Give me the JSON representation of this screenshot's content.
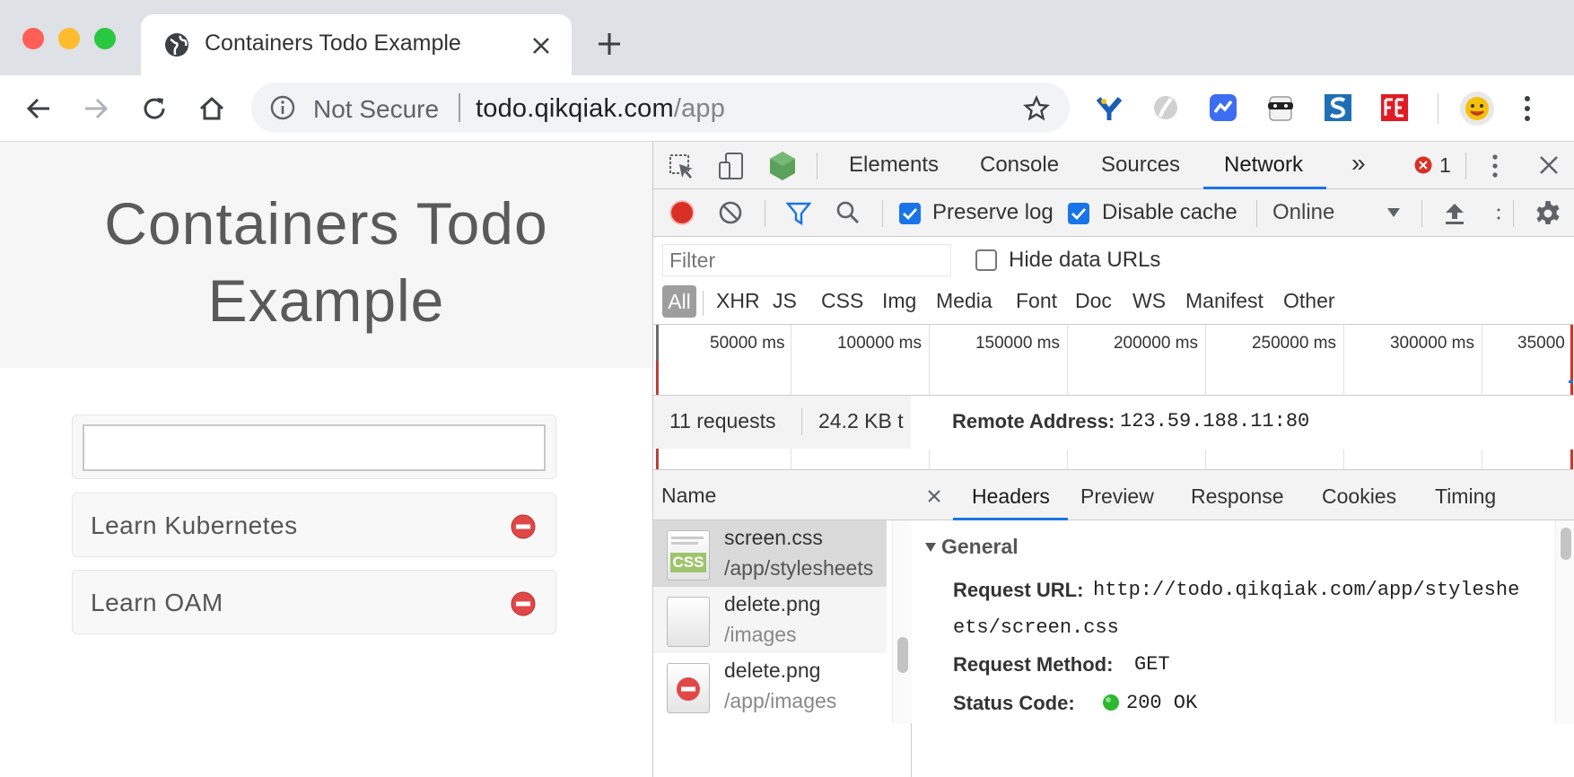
{
  "browser": {
    "tab_title": "Containers Todo Example",
    "omnibox": {
      "security_label": "Not Secure",
      "url_host": "todo.qikqiak.com",
      "url_path": "/app"
    }
  },
  "page": {
    "title_line1": "Containers Todo",
    "title_line2": "Example",
    "new_todo_value": "",
    "todos": [
      {
        "text": "Learn Kubernetes"
      },
      {
        "text": "Learn OAM"
      }
    ]
  },
  "devtools": {
    "tabs": [
      "Elements",
      "Console",
      "Sources",
      "Network"
    ],
    "active_tab": "Network",
    "more_tabs": "»",
    "error_count": "1",
    "controls": {
      "preserve_log": "Preserve log",
      "disable_cache": "Disable cache",
      "throttling": "Online"
    },
    "filter": {
      "placeholder": "Filter",
      "hide_data_urls": "Hide data URLs",
      "types": [
        "All",
        "XHR",
        "JS",
        "CSS",
        "Img",
        "Media",
        "Font",
        "Doc",
        "WS",
        "Manifest",
        "Other"
      ]
    },
    "overview_ticks": [
      "50000 ms",
      "100000 ms",
      "150000 ms",
      "200000 ms",
      "250000 ms",
      "300000 ms",
      "35000"
    ],
    "requests": {
      "column_name": "Name",
      "rows": [
        {
          "file": "screen.css",
          "path": "/app/stylesheets",
          "icon": "css-file-icon",
          "icon_label": "CSS"
        },
        {
          "file": "delete.png",
          "path": "/images",
          "icon": "image-file-icon"
        },
        {
          "file": "delete.png",
          "path": "/app/images",
          "icon": "delete-image-icon"
        }
      ],
      "summary_count": "11 requests",
      "summary_size": "24.2 KB t"
    },
    "details": {
      "tabs": [
        "Headers",
        "Preview",
        "Response",
        "Cookies",
        "Timing"
      ],
      "active_tab": "Headers",
      "section": "General",
      "request_url_label": "Request URL:",
      "request_url_line1": "http://todo.qikqiak.com/app/styleshe",
      "request_url_line2": "ets/screen.css",
      "method_label": "Request Method:",
      "method": "GET",
      "status_label": "Status Code:",
      "status": "200 OK",
      "remote_label": "Remote Address:",
      "remote": "123.59.188.11:80"
    }
  }
}
